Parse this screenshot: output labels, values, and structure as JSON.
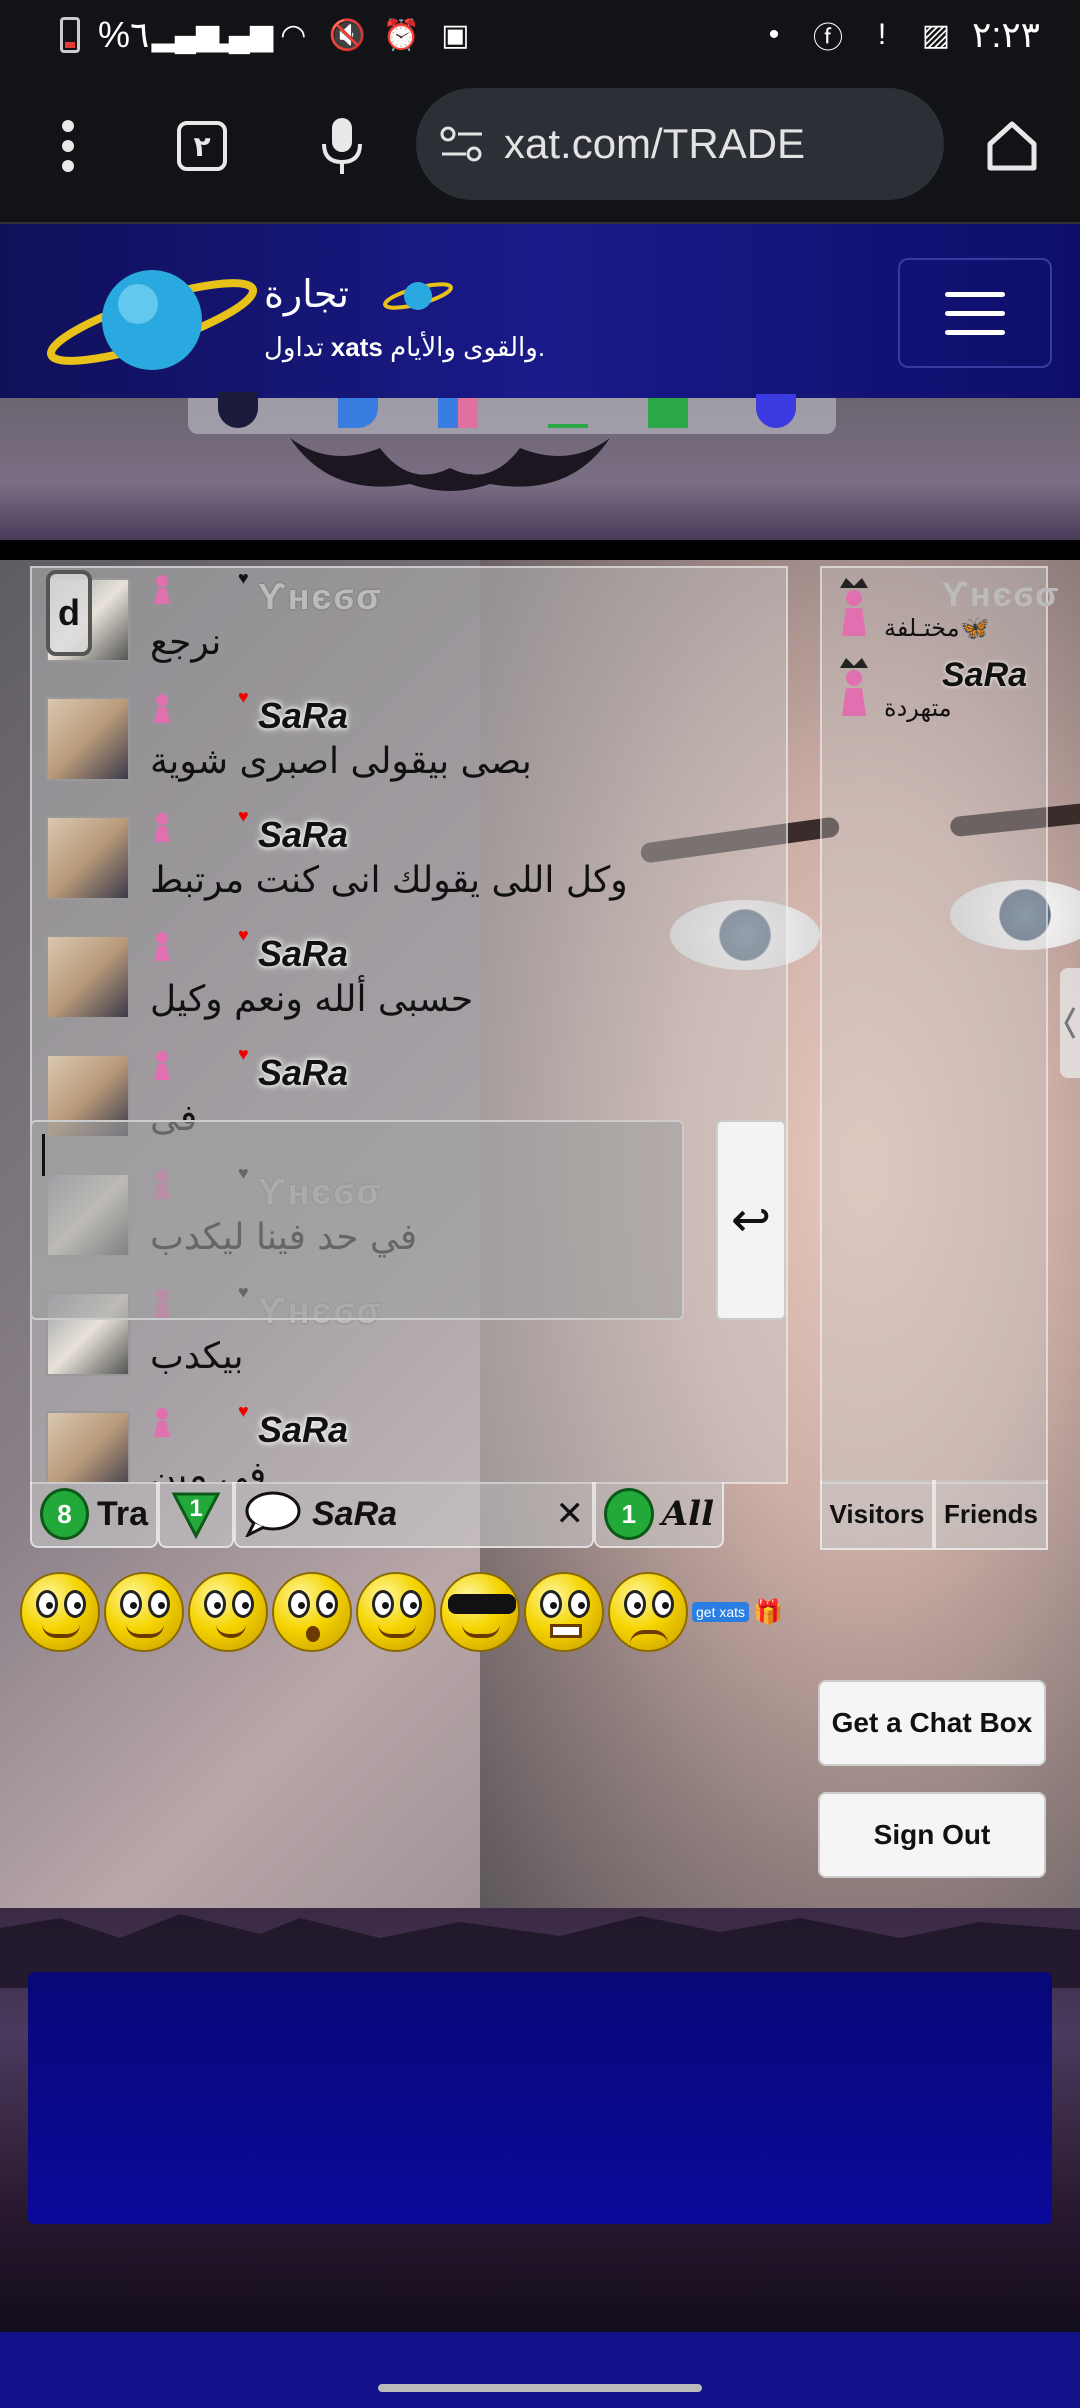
{
  "status_bar": {
    "battery_text": "%٦",
    "time": "٢:٢٣"
  },
  "browser": {
    "tab_count": "٢",
    "url": "xat.com/TRADE"
  },
  "site": {
    "title": "تجارة",
    "subtitle_prefix": "تداول",
    "subtitle_bold": "xats",
    "subtitle_suffix": "والقوى والأيام."
  },
  "chat": {
    "corner_badge": "d",
    "messages": [
      {
        "name": "ϒʜєϭσ",
        "text": "نرجع",
        "ghost": true
      },
      {
        "name": "SaRa",
        "text": "بصى بيقولى اصبرى شوية",
        "ghost": false
      },
      {
        "name": "SaRa",
        "text": "وكل اللى يقولك انى كنت مرتبط",
        "ghost": false
      },
      {
        "name": "SaRa",
        "text": "حسبى ألله ونعم وكيل",
        "ghost": false
      },
      {
        "name": "SaRa",
        "text": "فى",
        "ghost": false
      },
      {
        "name": "ϒʜєϭσ",
        "text": "في حد فينا ليكدب",
        "ghost": true
      },
      {
        "name": "ϒʜєϭσ",
        "text": "بيكدب",
        "ghost": true
      },
      {
        "name": "SaRa",
        "text": "فى مين",
        "ghost": false
      }
    ],
    "users": [
      {
        "name": "ϒʜєϭσ",
        "status": "مختـلفة🦋",
        "ghost": true
      },
      {
        "name": "SaRa",
        "status": "متهردة",
        "ghost": false
      }
    ],
    "tabs": {
      "main_count": "8",
      "main_label": "Tra",
      "tri_count": "1",
      "pc_name": "SaRa",
      "close_symbol": "✕",
      "all_count": "1",
      "all_label": "All"
    },
    "user_tabs": [
      "Visitors",
      "Friends"
    ],
    "get_xats_label": "get xats",
    "send_symbol": "↩",
    "get_chatbox_label": "Get a Chat Box",
    "sign_out_label": "Sign Out"
  },
  "colors": {
    "header_blue": "#1a1a8a",
    "badge_green": "#23a83a",
    "ad_blue": "#0a0a9a"
  }
}
